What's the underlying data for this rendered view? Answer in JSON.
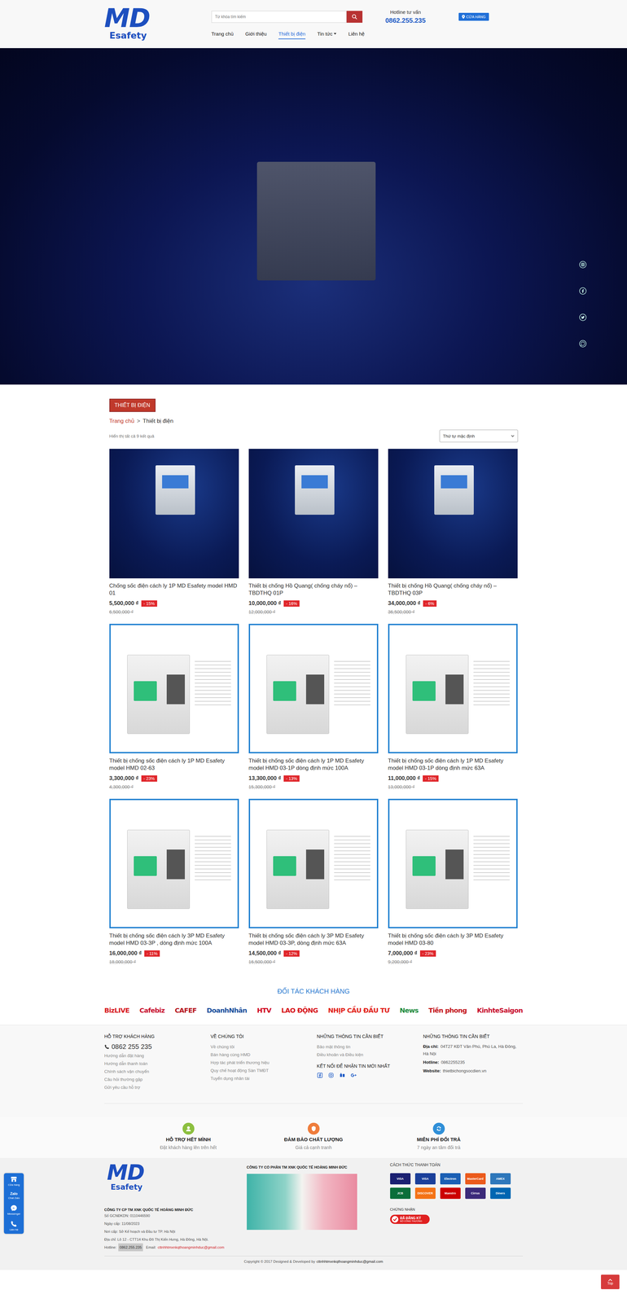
{
  "header": {
    "logo": {
      "mark": "MD",
      "name": "Esafety"
    },
    "search_placeholder": "Từ khóa tìm kiếm",
    "hotline_label": "Hotline tư vấn",
    "hotline": "0862.255.235",
    "store_button": "CỬA HÀNG"
  },
  "nav": [
    {
      "label": "Trang chủ",
      "selected": false,
      "dropdown": false
    },
    {
      "label": "Giới thiệu",
      "selected": false,
      "dropdown": false
    },
    {
      "label": "Thiết bị điện",
      "selected": true,
      "dropdown": false
    },
    {
      "label": "Tin tức",
      "selected": false,
      "dropdown": true
    },
    {
      "label": "Liên hệ",
      "selected": false,
      "dropdown": false
    }
  ],
  "page_title": "THIẾT BỊ ĐIỆN",
  "breadcrumb": {
    "items": [
      "Trang chủ",
      "Thiết bị điện"
    ],
    "separator": ">"
  },
  "result_count": "Hiển thị tất cả 9 kết quả",
  "sort": "Thứ tự mặc định",
  "products": [
    {
      "kind": "dark",
      "name": "Chống sốc điện cách ly 1P MD Esafety model HMD 01",
      "price": "5,500,000 ₫",
      "discount": "- 15%",
      "old_price": "6,500,000 ₫"
    },
    {
      "kind": "dark",
      "name": "Thiết bị chống Hồ Quang( chống cháy nổ) – TBDTHQ 01P",
      "price": "10,000,000 ₫",
      "discount": "- 16%",
      "old_price": "12,000,000 ₫"
    },
    {
      "kind": "dark",
      "name": "Thiết bị chống Hồ Quang( chống cháy nổ) – TBDTHQ 03P",
      "price": "34,000,000 ₫",
      "discount": "- 6%",
      "old_price": "36,500,000 ₫"
    },
    {
      "kind": "framed",
      "name": "Thiết bị chống sốc điện cách ly 1P MD Esafety model HMD 02-63",
      "price": "3,300,000 ₫",
      "discount": "- 23%",
      "old_price": "4,300,000 ₫"
    },
    {
      "kind": "framed",
      "name": "Thiết bị chống sốc điện cách ly 1P MD Esafety model HMD 03-1P dòng định mức 100A",
      "price": "13,300,000 ₫",
      "discount": "- 13%",
      "old_price": "15,300,000 ₫"
    },
    {
      "kind": "framed",
      "name": "Thiết bị chống sốc điện cách ly 1P MD Esafety model HMD 03-1P dòng định mức 63A",
      "price": "11,000,000 ₫",
      "discount": "- 15%",
      "old_price": "13,000,000 ₫"
    },
    {
      "kind": "framed",
      "name": "Thiết bị chống sốc điện cách ly 3P MD Esafety model HMD 03-3P , dòng định mức 100A",
      "price": "16,000,000 ₫",
      "discount": "- 11%",
      "old_price": "18,000,000 ₫"
    },
    {
      "kind": "framed",
      "name": "Thiết bị chống sốc điện cách ly 3P MD Esafety model HMD 03-3P, dòng định mức 63A",
      "price": "14,500,000 ₫",
      "discount": "- 12%",
      "old_price": "16,500,000 ₫"
    },
    {
      "kind": "framed",
      "name": "Thiết bị chống sốc điện cách ly 3P MD Esafety model HMD 03-80",
      "price": "7,000,000 ₫",
      "discount": "- 23%",
      "old_price": "9,200,000 ₫"
    }
  ],
  "partners": {
    "title": "ĐỐI TÁC KHÁCH HÀNG",
    "logos": [
      {
        "label": "BizLIVE",
        "color": "#d71920"
      },
      {
        "label": "Cafebiz",
        "color": "#c8102e"
      },
      {
        "label": "CAFEF",
        "color": "#b5121b"
      },
      {
        "label": "DoanhNhân",
        "color": "#1b4f9c"
      },
      {
        "label": "HTV",
        "color": "#d0021b"
      },
      {
        "label": "LAO ĐỘNG",
        "color": "#d7141a"
      },
      {
        "label": "NHỊP CẦU ĐẦU TƯ",
        "color": "#e2231a"
      },
      {
        "label": "News",
        "color": "#1b8a3c"
      },
      {
        "label": "Tiền phong",
        "color": "#c4161c"
      },
      {
        "label": "KinhteSaigon",
        "color": "#c8102e"
      }
    ]
  },
  "footer": {
    "support": {
      "title": "HỖ TRỢ KHÁCH HÀNG",
      "phone": "0862 255 235",
      "links": [
        "Hướng dẫn đặt hàng",
        "Hướng dẫn thanh toán",
        "Chính sách vận chuyển",
        "Câu hỏi thường gặp",
        "Gửi yêu cầu hỗ trợ"
      ]
    },
    "about": {
      "title": "VỀ CHÚNG TÔI",
      "links": [
        "Về chúng tôi",
        "Bán hàng cùng HMD",
        "Hợp tác phát triển thương hiệu",
        "Quy chế hoạt động Sàn TMĐT",
        "Tuyển dụng nhân tài"
      ]
    },
    "info": {
      "title": "NHỮNG THÔNG TIN CẦN BIẾT",
      "links": [
        "Bảo mật thông tin",
        "Điều khoản và Điều kiện"
      ],
      "connect_title": "KẾT NỐI ĐỂ NHẬN TIN MỚI NHẤT"
    },
    "contact": {
      "title": "NHỮNG THÔNG TIN CẦN BIẾT",
      "rows": [
        {
          "label": "Địa chỉ:",
          "value": "04T27 KĐT Văn Phú, Phú La, Hà Đông, Hà Nội"
        },
        {
          "label": "Hotline:",
          "value": "0862255235"
        },
        {
          "label": "Website:",
          "value": "thietbichongsocdien.vn"
        }
      ]
    }
  },
  "features": [
    {
      "title": "HỖ TRỢ HẾT MÌNH",
      "subtitle": "Đặt khách hàng lên trên hết",
      "color": "#8cbf3f"
    },
    {
      "title": "ĐẢM BẢO CHẤT LƯỢNG",
      "subtitle": "Giá cả cạnh tranh",
      "color": "#ef7d3c"
    },
    {
      "title": "MIỄN PHÍ ĐỔI TRẢ",
      "subtitle": "7 ngày an tâm đổi trả",
      "color": "#2f8fd8"
    }
  ],
  "company": {
    "logo": {
      "mark": "MD",
      "name": "Esafety"
    },
    "name": "CÔNG TY CP TM XNK QUỐC TẾ HOÀNG MINH ĐỨC",
    "lines": [
      "Số GCNĐKDN: 0110446590",
      "Ngày cấp: 11/08/2023",
      "Nơi cấp: Sở Kế hoạch và Đầu tư TP. Hà Nội",
      "Địa chỉ: Lô 12 - CTT14 Khu Đô Thị Kiến Hưng, Hà Đông, Hà Nội."
    ],
    "hotline_label": "Hotline:",
    "hotline": "0862.255.235",
    "email_label": "Email:",
    "email": "cttnhhtmxnkqthoangminhduc@gmail.com"
  },
  "showcase_title": "CÔNG TY CỔ PHẦN TM XNK QUỐC TẾ HOÀNG MINH ĐỨC",
  "payment": {
    "title": "CÁCH THỨC THANH TOÁN",
    "cards": [
      {
        "label": "VISA",
        "color": "#1a1f71"
      },
      {
        "label": "VISA",
        "color": "#1a3f9a"
      },
      {
        "label": "Electron",
        "color": "#1a5fb4"
      },
      {
        "label": "MasterCard",
        "color": "#eb5a1b"
      },
      {
        "label": "AMEX",
        "color": "#2e77bb"
      },
      {
        "label": "JCB",
        "color": "#0b6e3a"
      },
      {
        "label": "DISCOVER",
        "color": "#f47216"
      },
      {
        "label": "Maestro",
        "color": "#cc0000"
      },
      {
        "label": "Cirrus",
        "color": "#3b2a7a"
      },
      {
        "label": "Diners",
        "color": "#0066b2"
      }
    ]
  },
  "certificate": {
    "title": "CHỨNG NHẬN",
    "badge": "ĐÃ ĐĂNG KÝ",
    "badge_sub": "BỘ CÔNG THƯƠNG"
  },
  "copyright": {
    "text": "Copyright © 2017 Designed & Developed by",
    "email": "cttnhhtmxnkqthoangminhduc@gmail.com"
  },
  "side_bar": [
    {
      "label": "Cửa hàng"
    },
    {
      "label": "Chat Zalo",
      "icon_text": "Zalo"
    },
    {
      "label": "Messenger"
    },
    {
      "label": "Liên hệ"
    }
  ],
  "top_button": "Top"
}
